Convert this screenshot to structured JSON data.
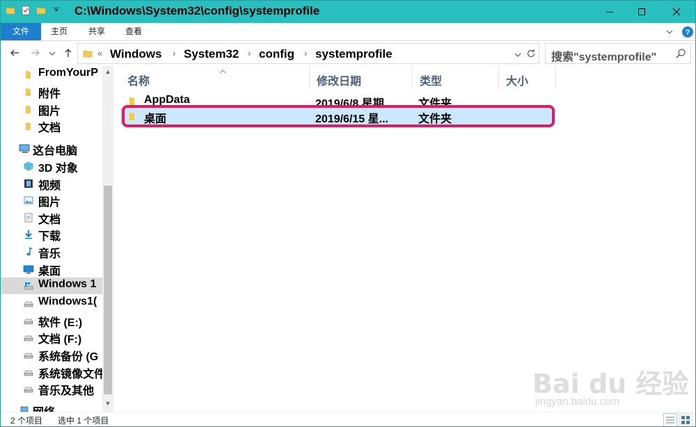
{
  "window": {
    "title": "C:\\Windows\\System32\\config\\systemprofile",
    "colors": {
      "titlebar": "#2abfbf",
      "file_tab": "#1e7fcf",
      "highlight": "#e8185e",
      "selection": "#cce8ff"
    }
  },
  "ribbon": {
    "tabs": [
      {
        "label": "文件"
      },
      {
        "label": "主页"
      },
      {
        "label": "共享"
      },
      {
        "label": "查看"
      }
    ]
  },
  "address": {
    "crumbs": [
      "Windows",
      "System32",
      "config",
      "systemprofile"
    ],
    "overflow_label": "«"
  },
  "search": {
    "placeholder": "搜索\"systemprofile\""
  },
  "navpane": {
    "items": [
      {
        "label": "FromYourP",
        "icon": "folder-icon"
      },
      {
        "label": "附件",
        "icon": "folder-icon"
      },
      {
        "label": "图片",
        "icon": "folder-icon"
      },
      {
        "label": "文档",
        "icon": "folder-icon"
      },
      {
        "label": "这台电脑",
        "icon": "computer-icon"
      },
      {
        "label": "3D 对象",
        "icon": "3d-objects-icon"
      },
      {
        "label": "视频",
        "icon": "video-icon"
      },
      {
        "label": "图片",
        "icon": "pictures-icon"
      },
      {
        "label": "文档",
        "icon": "documents-icon"
      },
      {
        "label": "下载",
        "icon": "download-icon"
      },
      {
        "label": "音乐",
        "icon": "music-icon"
      },
      {
        "label": "桌面",
        "icon": "desktop-icon"
      },
      {
        "label": "Windows 1",
        "icon": "windows-drive-icon"
      },
      {
        "label": "Windows1(",
        "icon": "drive-icon"
      },
      {
        "label": "软件 (E:)",
        "icon": "drive-icon"
      },
      {
        "label": "文档 (F:)",
        "icon": "drive-icon"
      },
      {
        "label": "系统备份 (G",
        "icon": "drive-icon"
      },
      {
        "label": "系统镜像文件",
        "icon": "drive-icon"
      },
      {
        "label": "音乐及其他",
        "icon": "drive-icon"
      },
      {
        "label": "网络",
        "icon": "network-icon"
      }
    ]
  },
  "columns": [
    {
      "label": "名称"
    },
    {
      "label": "修改日期"
    },
    {
      "label": "类型"
    },
    {
      "label": "大小"
    }
  ],
  "files": [
    {
      "name": "AppData",
      "date": "2019/6/8 星期...",
      "type": "文件夹",
      "size": ""
    },
    {
      "name": "桌面",
      "date": "2019/6/15 星...",
      "type": "文件夹",
      "size": ""
    }
  ],
  "status": {
    "count": "2 个项目",
    "selected": "选中 1 个项目"
  },
  "watermark": {
    "brand": "Bai du 经验",
    "url": "jingyan.baidu.com"
  }
}
